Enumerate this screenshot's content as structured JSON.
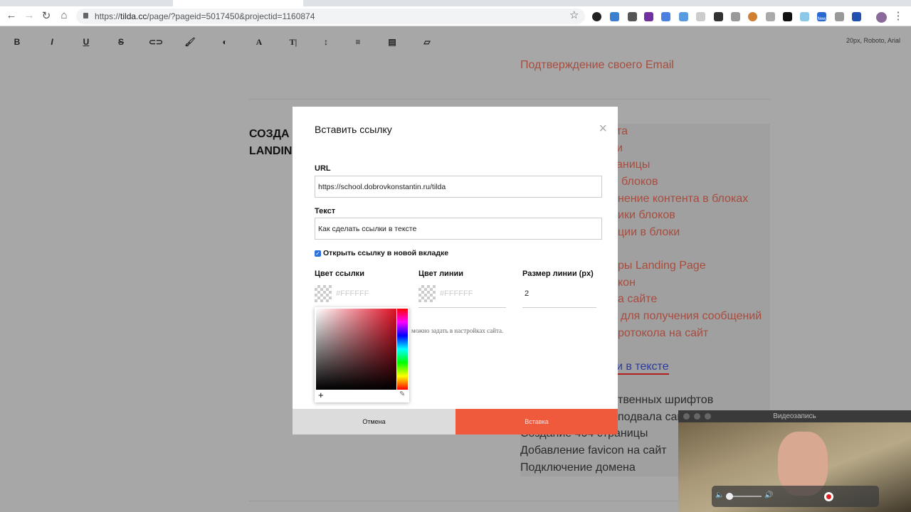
{
  "browser": {
    "url_scheme": "https://",
    "url_host": "tilda.cc",
    "url_path": "/page/?pageid=5017450&projectid=1160874",
    "badge_new": "New"
  },
  "editor_toolbar": {
    "buttons": [
      "B",
      "I",
      "U",
      "S",
      "⊂⊃",
      "🖌",
      "◐",
      "A",
      "T|",
      "↕",
      "≡",
      "▤",
      "▱"
    ],
    "font_info": "20px, Roboto, Arial"
  },
  "page": {
    "top_link": "Подтверждение своего Email",
    "heading_fragments": [
      "СОЗДА",
      "LANDIN"
    ],
    "list_fragments": [
      "та",
      "и",
      "аницы",
      "блоков",
      "нение контента в блоках",
      "ики блоков",
      "ции в блоки",
      "ры Landing Page",
      "кон",
      "а сайте",
      "для получения сообщений",
      "ротокола на сайт",
      "и в тексте",
      "твенных шрифтов",
      "подвала сай"
    ],
    "list_full": [
      "Создание 404 страницы",
      "Добавление favicon на сайт",
      "Подключение домена"
    ]
  },
  "modal": {
    "title": "Вставить ссылку",
    "close": "×",
    "url_label": "URL",
    "url_value": "https://school.dobrovkonstantin.ru/tilda",
    "text_label": "Текст",
    "text_value": "Как сделать ссылки в тексте",
    "new_tab_label": "Открыть ссылку в новой вкладке",
    "new_tab_checked": true,
    "link_color_label": "Цвет ссылки",
    "link_color_placeholder": "#FFFFFF",
    "line_color_label": "Цвет линии",
    "line_color_placeholder": "#FFFFFF",
    "line_size_label": "Размер линии (px)",
    "line_size_value": "2",
    "note": "можно задать в настройках сайта.",
    "cancel": "Отмена",
    "insert": "Вставка"
  },
  "video_window": {
    "title": "Видеозапись"
  },
  "colors": {
    "accent": "#f05a3c",
    "picker_hue": "#e01025"
  }
}
